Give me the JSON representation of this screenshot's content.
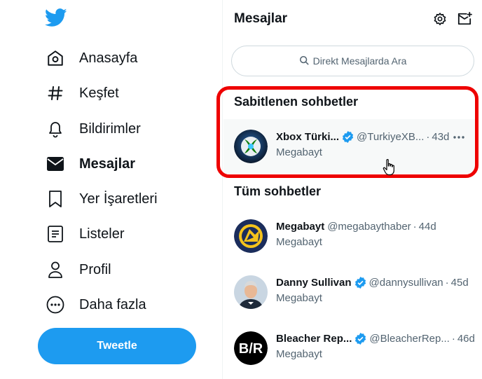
{
  "nav": {
    "logo_icon": "twitter-bird-icon",
    "items": [
      {
        "label": "Anasayfa",
        "icon": "home-icon"
      },
      {
        "label": "Keşfet",
        "icon": "hashtag-icon"
      },
      {
        "label": "Bildirimler",
        "icon": "bell-icon"
      },
      {
        "label": "Mesajlar",
        "icon": "envelope-icon",
        "active": true
      },
      {
        "label": "Yer İşaretleri",
        "icon": "bookmark-icon"
      },
      {
        "label": "Listeler",
        "icon": "list-icon"
      },
      {
        "label": "Profil",
        "icon": "person-icon"
      },
      {
        "label": "Daha fazla",
        "icon": "more-circle-icon"
      }
    ],
    "tweet_button": "Tweetle"
  },
  "messages": {
    "title": "Mesajlar",
    "search_placeholder": "Direkt Mesajlarda Ara",
    "pinned_title": "Sabitlenen sohbetler",
    "all_title": "Tüm sohbetler",
    "pinned": [
      {
        "name": "Xbox Türki...",
        "verified": true,
        "handle": "@TurkiyeXB...",
        "time": "43d",
        "preview": "Megabayt"
      }
    ],
    "conversations": [
      {
        "name": "Megabayt",
        "verified": false,
        "handle": "@megabaythaber",
        "time": "44d",
        "preview": "Megabayt"
      },
      {
        "name": "Danny Sullivan",
        "verified": true,
        "handle": "@dannysullivan",
        "time": "45d",
        "preview": "Megabayt"
      },
      {
        "name": "Bleacher Rep...",
        "verified": true,
        "handle": "@BleacherRep...",
        "time": "46d",
        "preview": "Megabayt"
      }
    ]
  },
  "colors": {
    "accent": "#1d9bf0",
    "highlight": "#ee0000",
    "text": "#0f1419",
    "secondary": "#536471"
  }
}
